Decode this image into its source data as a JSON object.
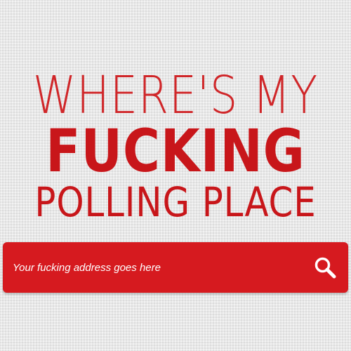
{
  "headline": {
    "line1": "WHERE'S MY",
    "line2": "FUCKING",
    "line3": "POLLING PLACE"
  },
  "search": {
    "placeholder": "Your fucking address goes here",
    "icon": "search-icon"
  },
  "colors": {
    "accent": "#d61a1f",
    "text_red": "#c8161a",
    "background": "#e8e8e8",
    "input_text": "#ffffff"
  }
}
